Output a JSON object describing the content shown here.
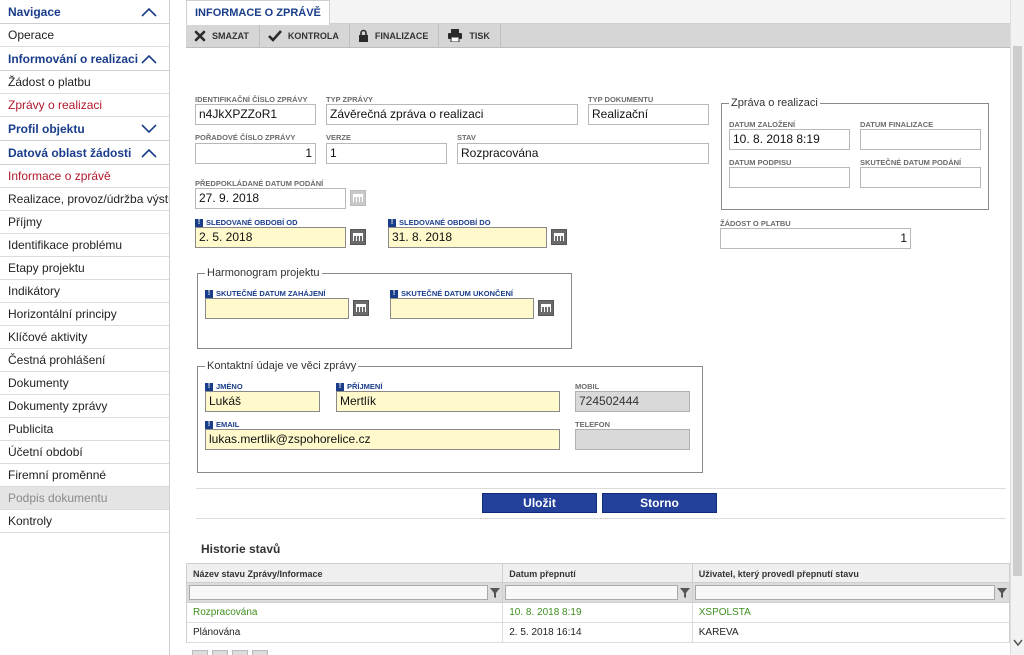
{
  "sidebar": {
    "sections": [
      {
        "title": "Navigace",
        "expanded": true,
        "items": [
          {
            "label": "Operace"
          }
        ]
      },
      {
        "title": "Informování o realizaci",
        "expanded": true,
        "items": [
          {
            "label": "Žádost o platbu"
          },
          {
            "label": "Zprávy o realizaci",
            "active": true
          }
        ]
      },
      {
        "title": "Profil objektu",
        "expanded": false,
        "items": []
      },
      {
        "title": "Datová oblast žádosti",
        "expanded": true,
        "items": [
          {
            "label": "Informace o zprávě",
            "active": true
          },
          {
            "label": "Realizace, provoz/údržba výstupu"
          },
          {
            "label": "Příjmy"
          },
          {
            "label": "Identifikace problému"
          },
          {
            "label": "Etapy projektu"
          },
          {
            "label": "Indikátory"
          },
          {
            "label": "Horizontální principy"
          },
          {
            "label": "Klíčové aktivity"
          },
          {
            "label": "Čestná prohlášení"
          },
          {
            "label": "Dokumenty"
          },
          {
            "label": "Dokumenty zprávy"
          },
          {
            "label": "Publicita"
          },
          {
            "label": "Účetní období"
          },
          {
            "label": "Firemní proměnné"
          },
          {
            "label": "Podpis dokumentu",
            "disabled": true
          },
          {
            "label": "Kontroly"
          }
        ]
      }
    ]
  },
  "tab": {
    "label": "INFORMACE O ZPRÁVĚ"
  },
  "toolbar": {
    "smazat": "SMAZAT",
    "kontrola": "KONTROLA",
    "finalizace": "FINALIZACE",
    "tisk": "TISK"
  },
  "form": {
    "id_label": "IDENTIFIKAČNÍ ČÍSLO ZPRÁVY",
    "id_value": "n4JkXPZZoR1",
    "typ_label": "TYP ZPRÁVY",
    "typ_value": "Závěrečná zpráva o realizaci",
    "typdok_label": "TYP DOKUMENTU",
    "typdok_value": "Realizační",
    "poradi_label": "POŘADOVÉ ČÍSLO ZPRÁVY",
    "poradi_value": "1",
    "verze_label": "VERZE",
    "verze_value": "1",
    "stav_label": "STAV",
    "stav_value": "Rozpracována",
    "predp_label": "PŘEDPOKLÁDANÉ DATUM PODÁNÍ",
    "predp_value": "27. 9. 2018",
    "od_label": "SLEDOVANÉ OBDOBÍ OD",
    "od_value": "2. 5. 2018",
    "do_label": "SLEDOVANÉ OBDOBÍ DO",
    "do_value": "31. 8. 2018",
    "zprava_legend": "Zpráva o realizaci",
    "zalozeni_label": "DATUM ZALOŽENÍ",
    "zalozeni_value": "10. 8. 2018 8:19",
    "finalizace_label": "DATUM FINALIZACE",
    "finalizace_value": "",
    "podpis_label": "DATUM PODPISU",
    "podpis_value": "",
    "podani_label": "SKUTEČNÉ DATUM PODÁNÍ",
    "podani_value": "",
    "zadost_label": "ŽÁDOST O PLATBU",
    "zadost_value": "1",
    "harm_legend": "Harmonogram projektu",
    "zahajeni_label": "SKUTEČNÉ DATUM ZAHÁJENÍ",
    "zahajeni_value": "",
    "ukonceni_label": "SKUTEČNÉ DATUM UKONČENÍ",
    "ukonceni_value": "",
    "kontakt_legend": "Kontaktní údaje ve věci zprávy",
    "jmeno_label": "JMÉNO",
    "jmeno_value": "Lukáš",
    "prijmeni_label": "PŘÍJMENÍ",
    "prijmeni_value": "Mertlík",
    "mobil_label": "MOBIL",
    "mobil_value": "724502444",
    "email_label": "EMAIL",
    "email_value": "lukas.mertlik@zspohorelice.cz",
    "telefon_label": "TELEFON",
    "telefon_value": ""
  },
  "buttons": {
    "ulozit": "Uložit",
    "storno": "Storno"
  },
  "history": {
    "title": "Historie stavů",
    "columns": [
      "Název stavu Zprávy/Informace",
      "Datum přepnutí",
      "Uživatel, který provedl přepnutí stavu"
    ],
    "rows": [
      {
        "stav": "Rozpracována",
        "datum": "10. 8. 2018 8:19",
        "uzivatel": "XSPOLSTA",
        "selected": true
      },
      {
        "stav": "Plánována",
        "datum": "2. 5. 2018 16:14",
        "uzivatel": "KAREVA",
        "selected": false
      }
    ]
  },
  "colors": {
    "accent": "#1a3d8a",
    "active_red": "#b3182c",
    "required_yellow": "#fff9cc",
    "button_blue": "#23409a",
    "selected_green": "#3f8f1f"
  }
}
